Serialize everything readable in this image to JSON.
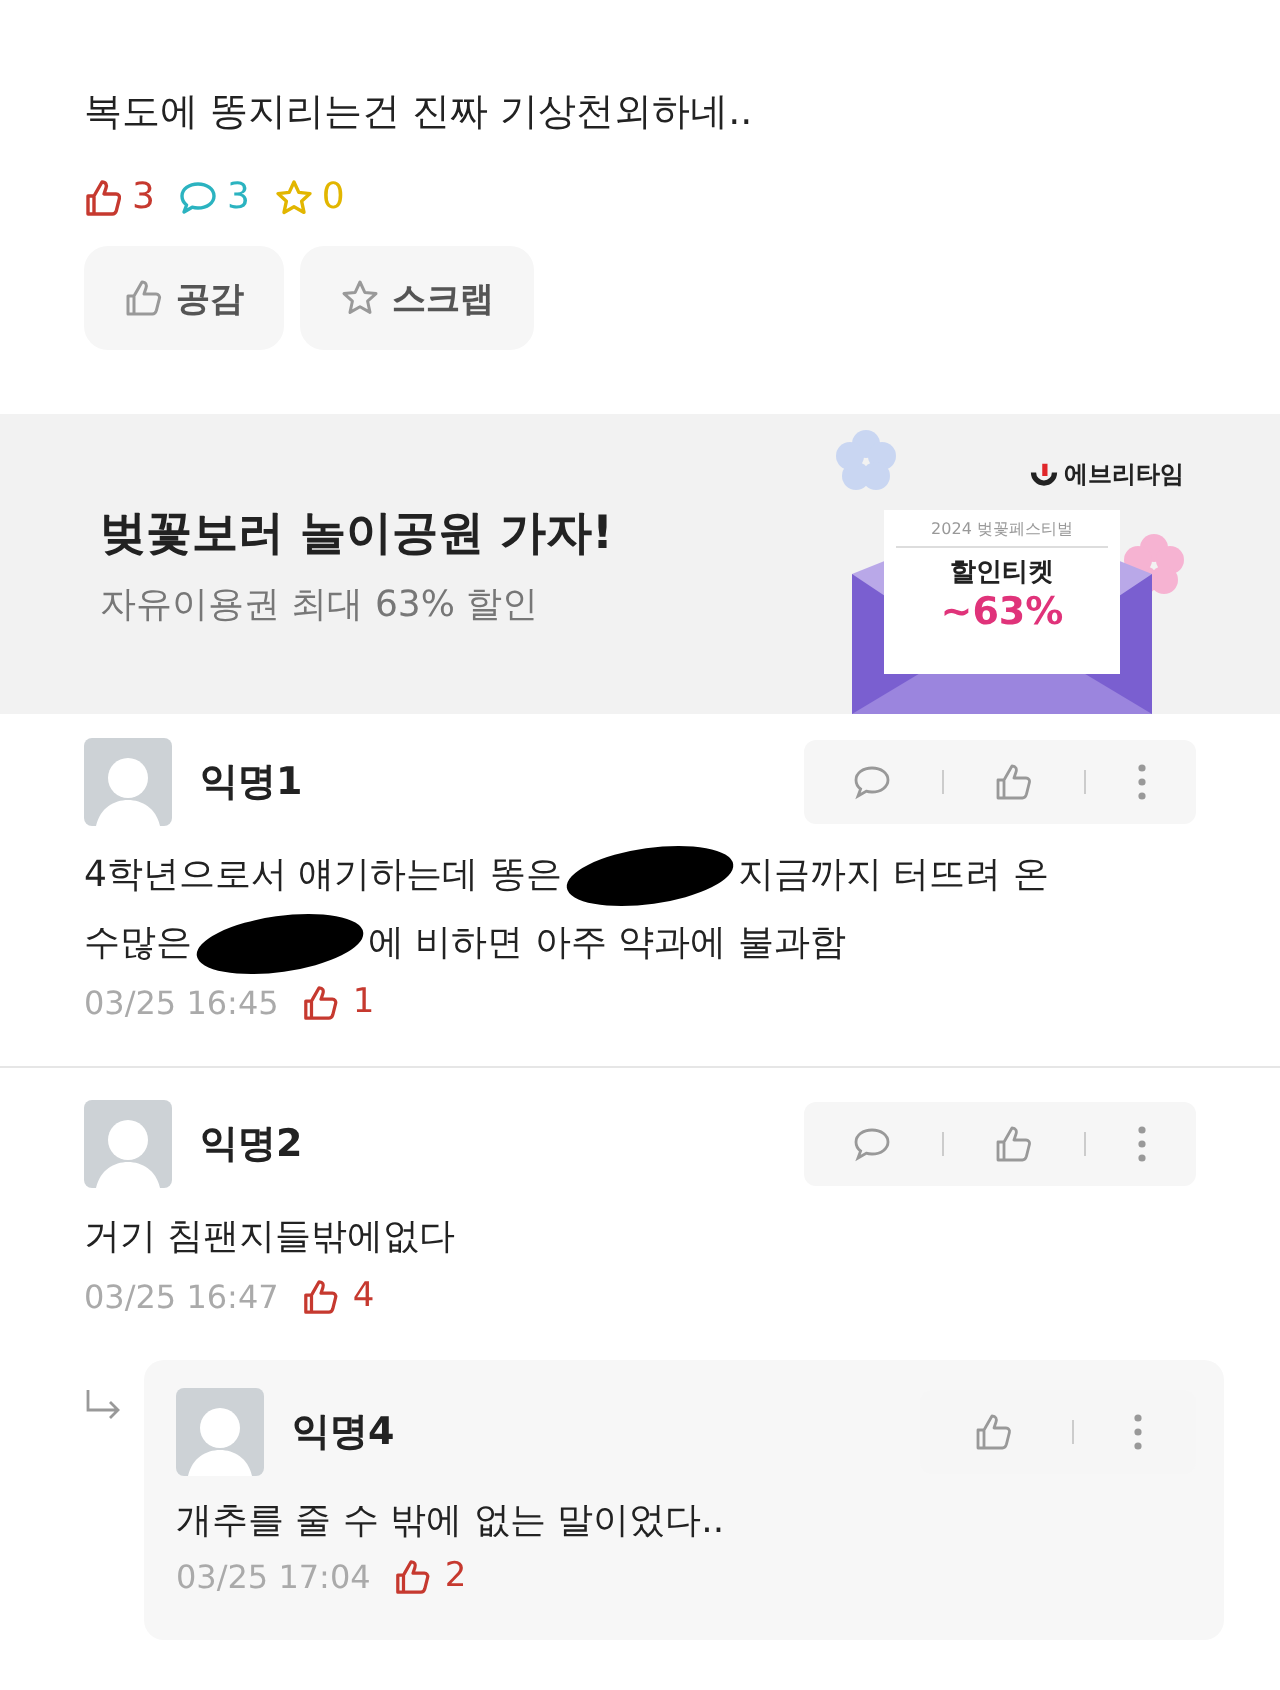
{
  "post": {
    "text": "복도에 똥지리는건 진짜 기상천외하네..",
    "likes": "3",
    "comments": "3",
    "scraps": "0",
    "buttons": [
      {
        "kind": "like",
        "label": "공감"
      },
      {
        "kind": "scrap",
        "label": "스크랩"
      }
    ]
  },
  "ad": {
    "title": "벚꽃보러 놀이공원 가자!",
    "subtitle": "자유이용권 최대 63% 할인",
    "brand": "에브리타임",
    "ticket_caption": "2024 벚꽃페스티벌",
    "ticket_title": "할인티켓",
    "ticket_discount": "~63%"
  },
  "comments": [
    {
      "kind": "comment",
      "author": "익명1",
      "lines": [
        [
          {
            "kind": "text",
            "text": "4학년으로서 얘기하는데 똥은"
          },
          {
            "kind": "redacted"
          },
          {
            "kind": "text",
            "text": "지금까지 터뜨려 온"
          }
        ],
        [
          {
            "kind": "text",
            "text": "수많은"
          },
          {
            "kind": "redacted"
          },
          {
            "kind": "text",
            "text": "에 비하면 아주 약과에 불과함"
          }
        ]
      ],
      "time": "03/25 16:45",
      "likes": "1"
    },
    {
      "kind": "comment",
      "author": "익명2",
      "lines": [
        [
          {
            "kind": "text",
            "text": "거기 침팬지들밖에없다"
          }
        ]
      ],
      "time": "03/25 16:47",
      "likes": "4",
      "replies": [
        {
          "author": "익명4",
          "lines": [
            [
              {
                "kind": "text",
                "text": "개추를 줄 수 밖에 없는 말이었다.."
              }
            ]
          ],
          "time": "03/25 17:04",
          "likes": "2"
        }
      ]
    }
  ]
}
